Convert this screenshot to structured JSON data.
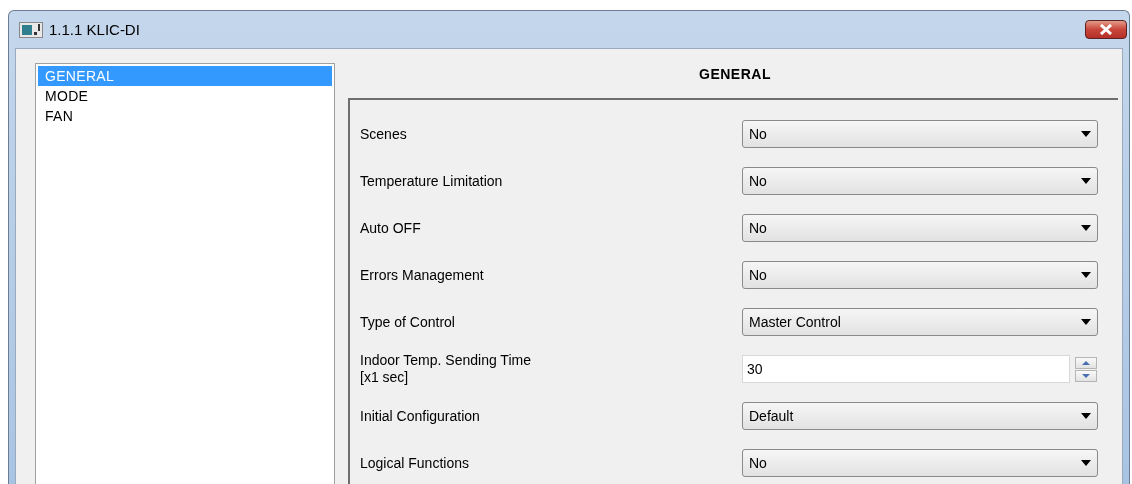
{
  "window": {
    "title": "1.1.1 KLIC-DI"
  },
  "sidebar": {
    "items": [
      {
        "label": "GENERAL",
        "selected": true
      },
      {
        "label": "MODE",
        "selected": false
      },
      {
        "label": "FAN",
        "selected": false
      }
    ]
  },
  "panel": {
    "heading": "GENERAL",
    "rows": [
      {
        "kind": "dropdown",
        "label": "Scenes",
        "value": "No"
      },
      {
        "kind": "dropdown",
        "label": "Temperature Limitation",
        "value": "No"
      },
      {
        "kind": "dropdown",
        "label": "Auto OFF",
        "value": "No"
      },
      {
        "kind": "dropdown",
        "label": "Errors Management",
        "value": "No"
      },
      {
        "kind": "dropdown",
        "label": "Type of Control",
        "value": "Master Control"
      },
      {
        "kind": "spin",
        "label": "Indoor Temp. Sending Time",
        "sublabel": "[x1 sec]",
        "value": "30"
      },
      {
        "kind": "dropdown",
        "label": "Initial Configuration",
        "value": "Default"
      },
      {
        "kind": "dropdown",
        "label": "Logical Functions",
        "value": "No"
      }
    ]
  }
}
